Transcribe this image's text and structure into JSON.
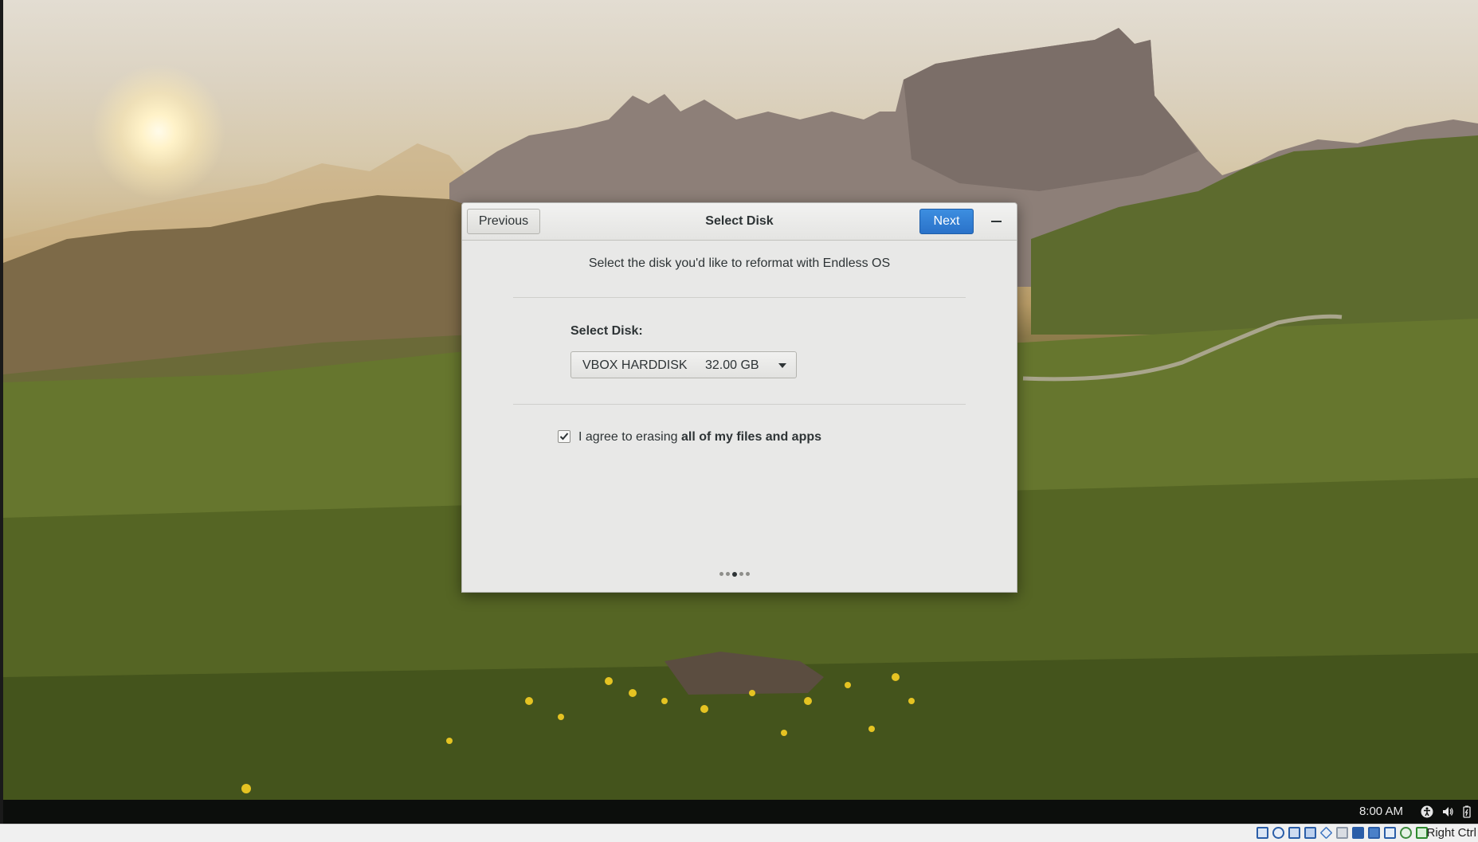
{
  "dialog": {
    "title": "Select Disk",
    "previous_label": "Previous",
    "next_label": "Next",
    "minimize_icon": "minimize-icon",
    "subtitle": "Select the disk you'd like to reformat with Endless OS",
    "disk_label": "Select Disk:",
    "disk_select": {
      "name": "VBOX HARDDISK",
      "size": "32.00 GB"
    },
    "agree": {
      "checked": true,
      "text_prefix": "I agree to erasing ",
      "text_bold": "all of my files and apps"
    },
    "pager": {
      "total": 5,
      "current": 3
    }
  },
  "taskbar": {
    "clock": "8:00 AM",
    "tray_icons": [
      "accessibility-icon",
      "volume-icon",
      "battery-icon"
    ]
  },
  "vbox_statusbar": {
    "icons": [
      "hard-disk-icon",
      "optical-drive-icon",
      "audio-icon",
      "network-icon",
      "usb-icon",
      "shared-folders-icon",
      "display-icon",
      "video-capture-icon",
      "virtualization-icon",
      "mouse-integration-icon",
      "keyboard-icon"
    ],
    "host_key": "Right Ctrl"
  },
  "colors": {
    "accent": "#2a72c9",
    "dialog_bg": "#e8e8e7",
    "text": "#2e3436"
  }
}
